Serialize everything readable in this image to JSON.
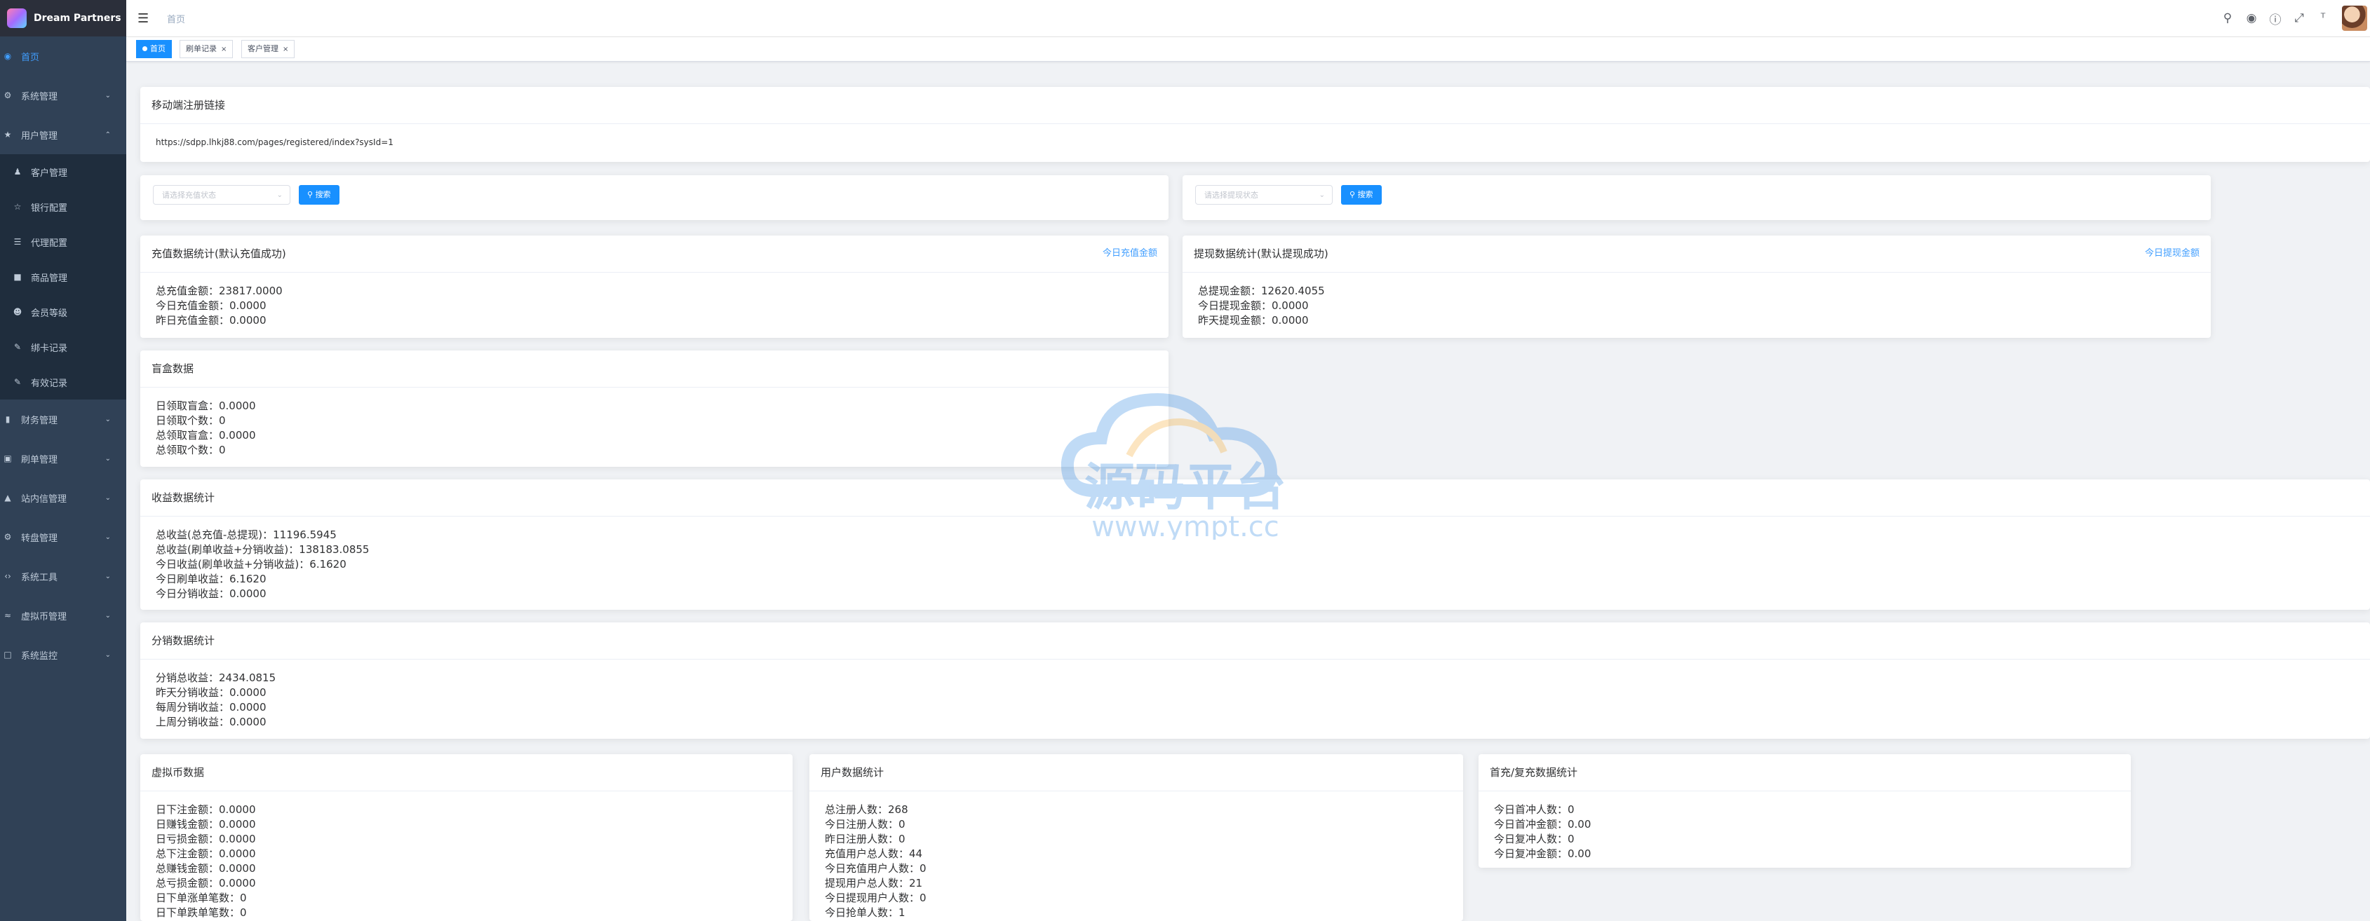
{
  "app": {
    "logo_title": "Dream Partners"
  },
  "sidebar": {
    "items": [
      {
        "label": "首页",
        "icon": "dashboard-icon",
        "active": true
      },
      {
        "label": "系统管理",
        "icon": "gear-icon"
      },
      {
        "label": "用户管理",
        "icon": "star-icon",
        "expanded": true,
        "children": [
          {
            "label": "客户管理",
            "icon": "users-icon"
          },
          {
            "label": "银行配置",
            "icon": "star-outline-icon"
          },
          {
            "label": "代理配置",
            "icon": "tree-icon"
          },
          {
            "label": "商品管理",
            "icon": "shirt-icon"
          },
          {
            "label": "会员等级",
            "icon": "group-icon"
          },
          {
            "label": "绑卡记录",
            "icon": "edit-icon"
          },
          {
            "label": "有效记录",
            "icon": "edit-icon"
          }
        ]
      },
      {
        "label": "财务管理",
        "icon": "chart-icon"
      },
      {
        "label": "刷单管理",
        "icon": "cart-icon"
      },
      {
        "label": "站内信管理",
        "icon": "folder-icon"
      },
      {
        "label": "转盘管理",
        "icon": "gear-icon"
      },
      {
        "label": "系统工具",
        "icon": "code-icon"
      },
      {
        "label": "虚拟币管理",
        "icon": "wave-icon"
      },
      {
        "label": "系统监控",
        "icon": "monitor-icon"
      }
    ]
  },
  "header": {
    "breadcrumb": "首页",
    "icons": [
      "search-icon",
      "github-icon",
      "question-icon",
      "fullscreen-icon",
      "font-size-icon"
    ]
  },
  "tags": [
    {
      "label": "首页",
      "active": true
    },
    {
      "label": "刷单记录"
    },
    {
      "label": "客户管理"
    }
  ],
  "register_link": {
    "title": "移动端注册链接",
    "url": "https://sdpp.lhkj88.com/pages/registered/index?sysId=1"
  },
  "search": {
    "recharge_placeholder": "请选择充值状态",
    "withdraw_placeholder": "请选择提现状态",
    "button_label": "搜索"
  },
  "recharge": {
    "title": "充值数据统计(默认充值成功)",
    "link": "今日充值金额",
    "lines": [
      "总充值金额：23817.0000",
      "今日充值金额：0.0000",
      "昨日充值金额：0.0000"
    ]
  },
  "withdraw": {
    "title": "提现数据统计(默认提现成功)",
    "link": "今日提现金额",
    "lines": [
      "总提现金额：12620.4055",
      "今日提现金额：0.0000",
      "昨天提现金额：0.0000"
    ]
  },
  "blindbox": {
    "title": "盲盒数据",
    "lines": [
      "日领取盲盒：0.0000",
      "日领取个数：0",
      "总领取盲盒：0.0000",
      "总领取个数：0"
    ]
  },
  "income": {
    "title": "收益数据统计",
    "lines": [
      "总收益(总充值-总提现)：11196.5945",
      "总收益(刷单收益+分销收益)：138183.0855",
      "今日收益(刷单收益+分销收益)：6.1620",
      "今日刷单收益：6.1620",
      "今日分销收益：0.0000"
    ]
  },
  "distribution": {
    "title": "分销数据统计",
    "lines": [
      "分销总收益：2434.0815",
      "昨天分销收益：0.0000",
      "每周分销收益：0.0000",
      "上周分销收益：0.0000"
    ]
  },
  "crypto": {
    "title": "虚拟币数据",
    "lines": [
      "日下注金额：0.0000",
      "日赚钱金额：0.0000",
      "日亏损金额：0.0000",
      "总下注金额：0.0000",
      "总赚钱金额：0.0000",
      "总亏损金额：0.0000",
      "日下单涨单笔数：0",
      "日下单跌单笔数：0"
    ]
  },
  "users": {
    "title": "用户数据统计",
    "lines": [
      "总注册人数：268",
      "今日注册人数：0",
      "昨日注册人数：0",
      "充值用户总人数：44",
      "今日充值用户人数：0",
      "提现用户总人数：21",
      "今日提现用户人数：0",
      "今日抢单人数：1"
    ]
  },
  "first_recharge": {
    "title": "首充/复充数据统计",
    "lines": [
      "今日首冲人数：0",
      "今日首冲金额：0.00",
      "今日复冲人数：0",
      "今日复冲金额：0.00"
    ]
  },
  "watermark": {
    "text": "源码平台",
    "url": "www.ympt.cc"
  },
  "colors": {
    "sidebar_bg": "#304156",
    "accent": "#1890ff",
    "page_bg": "#f0f2f5"
  }
}
